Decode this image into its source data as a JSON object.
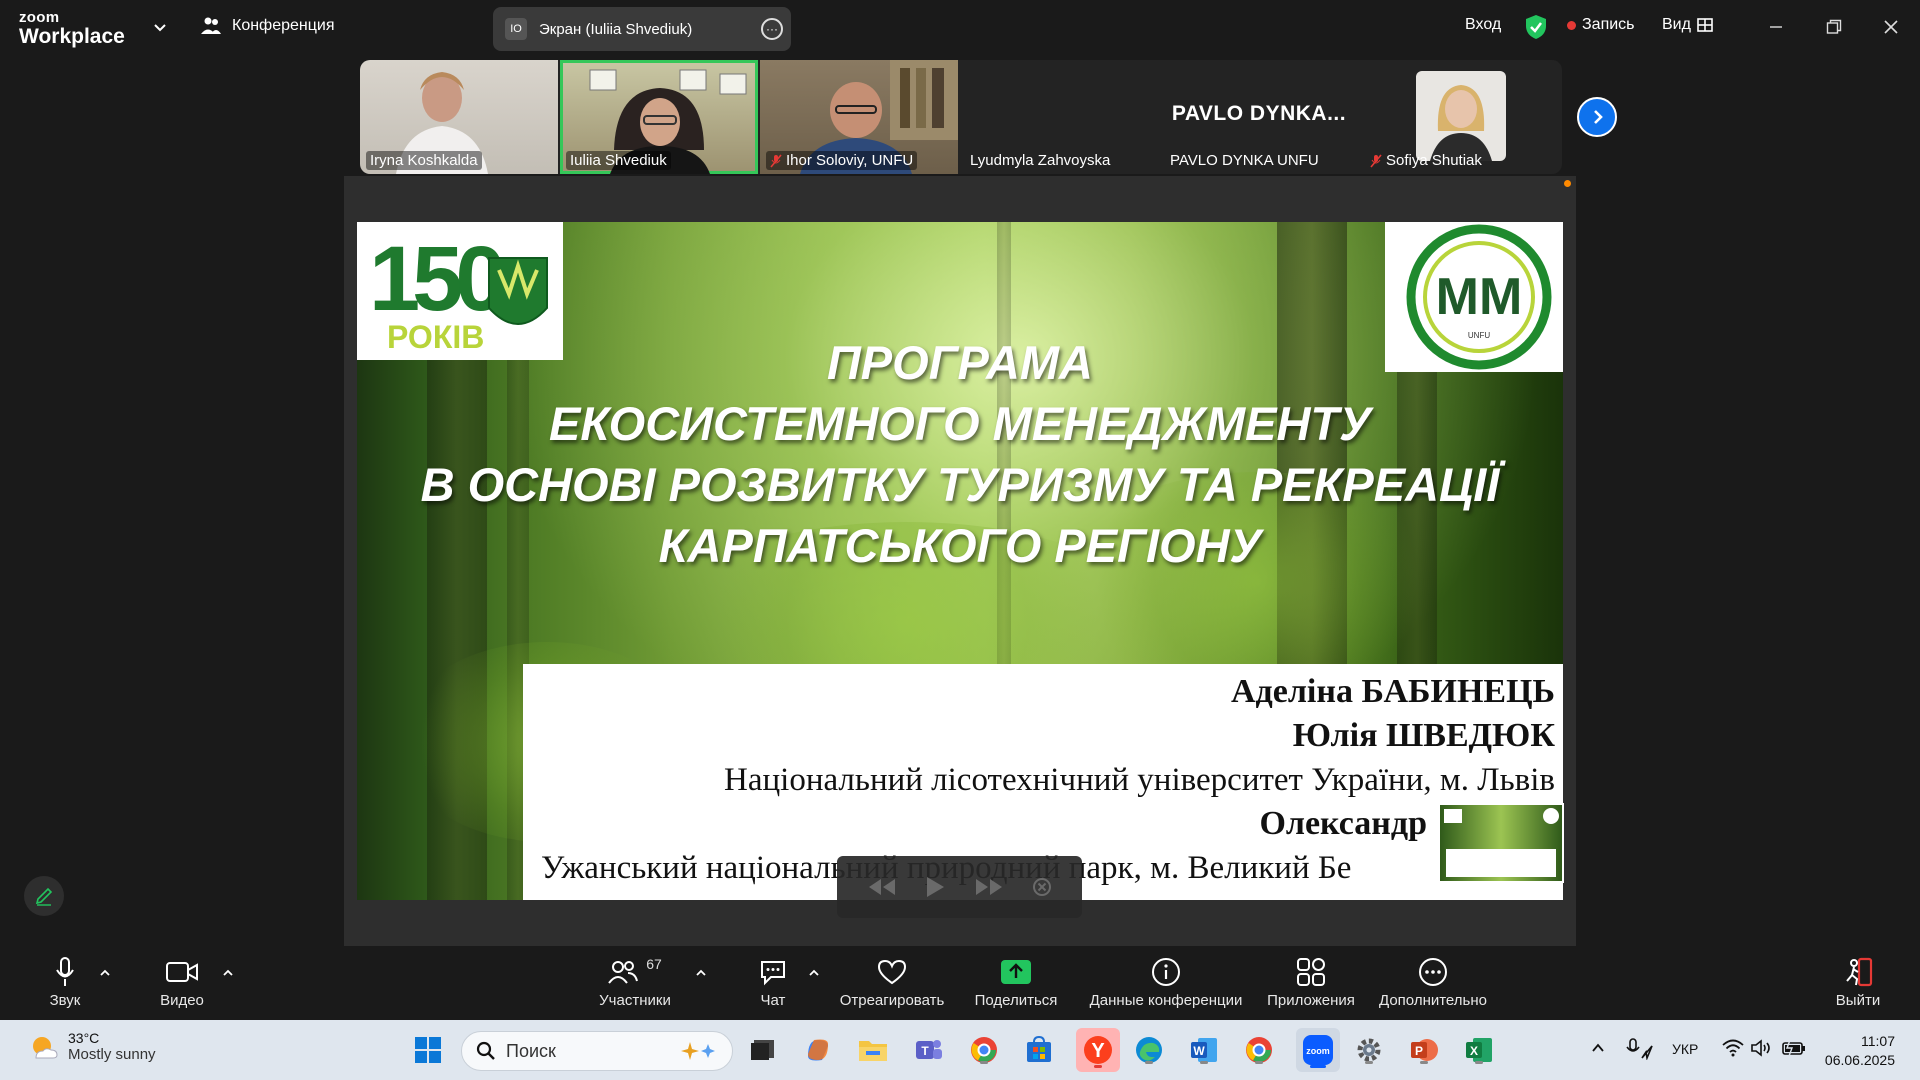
{
  "titlebar": {
    "logo_line1": "zoom",
    "logo_line2": "Workplace",
    "conference_label": "Конференция",
    "share_initials": "IO",
    "share_label": "Экран (Iuliia Shvediuk)",
    "signin_label": "Вход",
    "record_label": "Запись",
    "view_label": "Вид"
  },
  "participants": [
    {
      "name": "Iryna Koshkalda",
      "muted": false
    },
    {
      "name": "Iuliia Shvediuk",
      "muted": false
    },
    {
      "name": "Ihor Soloviy, UNFU",
      "muted": true
    },
    {
      "name": "Lyudmyla Zahvoyska",
      "muted": false
    },
    {
      "name": "PAVLO DYNKA  UNFU",
      "muted": false,
      "display": "PAVLO DYNKA..."
    },
    {
      "name": "Sofiya Shutiak",
      "muted": true
    }
  ],
  "slide": {
    "logo_left_number": "150",
    "logo_left_word": "РОКІВ",
    "logo_right_text": "MM",
    "logo_right_sub": "UNFU",
    "title_lines": [
      "ПРОГРАМА",
      "ЕКОСИСТЕМНОГО МЕНЕДЖМЕНТУ",
      "В ОСНОВІ РОЗВИТКУ ТУРИЗМУ ТА РЕКРЕАЦІЇ",
      "КАРПАТСЬКОГО РЕГІОНУ"
    ],
    "author1": "Аделіна БАБИНЕЦЬ",
    "author2": "Юлія ШВЕДЮК",
    "affil1": "Національний лісотехнічний університет України, м. Львів",
    "author3": "Олександр",
    "affil2": "Ужанський національний природний парк, м. Великий Бе"
  },
  "toolbar": {
    "audio": "Звук",
    "video": "Видео",
    "participants": "Участники",
    "participants_count": "67",
    "chat": "Чат",
    "react": "Отреагировать",
    "share": "Поделиться",
    "info": "Данные конференции",
    "apps": "Приложения",
    "more": "Дополнительно",
    "leave": "Выйти"
  },
  "taskbar": {
    "temp": "33°C",
    "weather": "Mostly sunny",
    "search_placeholder": "Поиск",
    "lang": "УКР",
    "time": "11:07",
    "date": "06.06.2025"
  },
  "colors": {
    "accent": "#0e72ed",
    "active_speaker": "#35c759",
    "record": "#e53935",
    "share_green": "#22c55e"
  }
}
